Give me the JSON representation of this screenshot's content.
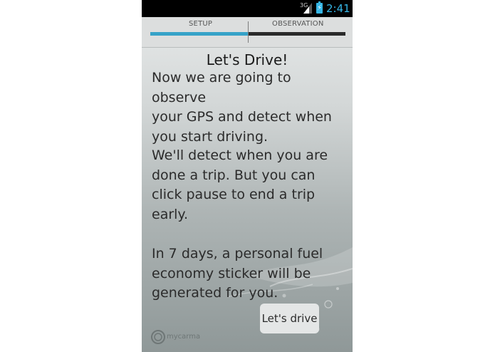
{
  "status_bar": {
    "network": "3G",
    "time": "2:41",
    "accent_color": "#35b5e5"
  },
  "tabs": {
    "items": [
      {
        "label": "SETUP",
        "active": true
      },
      {
        "label": "OBSERVATION",
        "active": false
      }
    ],
    "progress_color": "#36a2c8"
  },
  "main": {
    "title": "Let's Drive!",
    "paragraphs": [
      "Now we are going to observe\nyour GPS and detect when\nyou start driving.",
      "We'll detect when you are\ndone a trip.  But you can\nclick pause to end a trip\nearly.",
      "In 7 days, a personal fuel\neconomy sticker will be\ngenerated for you."
    ],
    "button_label": "Let's drive"
  },
  "logo": {
    "text": "mycarma",
    "icon": "mycarma-logo-icon"
  }
}
